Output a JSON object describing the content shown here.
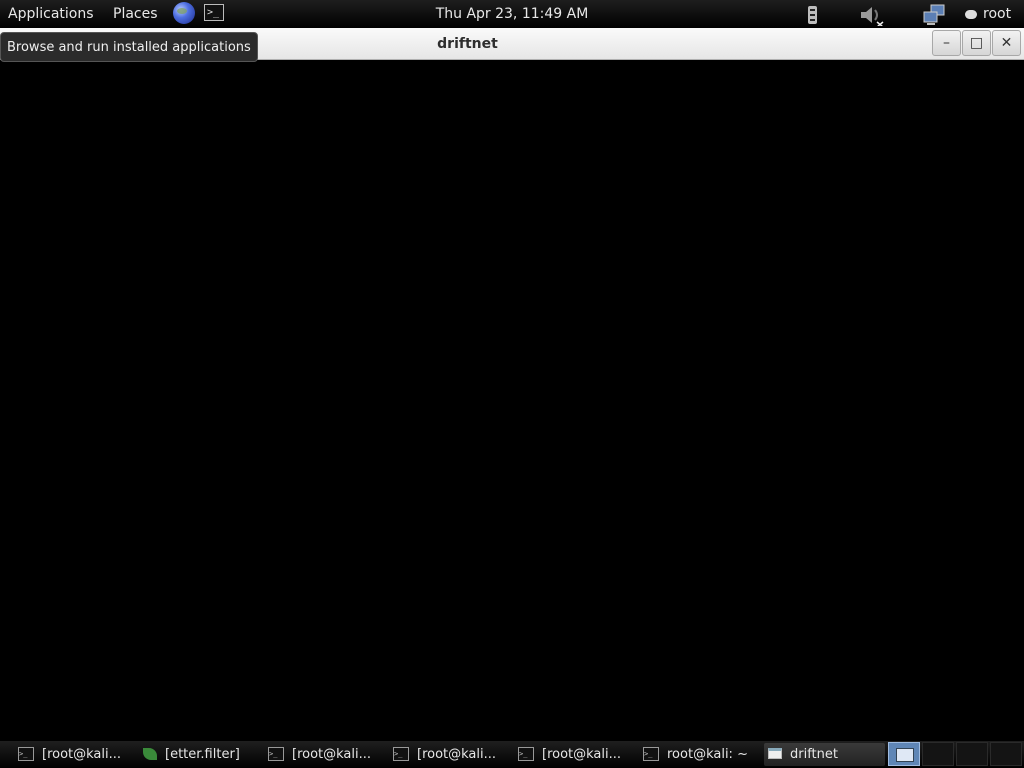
{
  "top_panel": {
    "applications_label": "Applications",
    "places_label": "Places",
    "terminal_launcher_glyph": ">_",
    "clock": "Thu Apr 23, 11:49 AM",
    "user_label": "root"
  },
  "tooltip": {
    "text": "Browse and run installed applications"
  },
  "window": {
    "title": "driftnet",
    "minimize_glyph": "–",
    "maximize_glyph": "□",
    "close_glyph": "✕"
  },
  "taskbar": {
    "tasks": [
      {
        "label": "[root@kali...",
        "icon": "terminal-icon"
      },
      {
        "label": "[etter.filter]",
        "icon": "text-editor-icon"
      },
      {
        "label": "[root@kali...",
        "icon": "terminal-icon"
      },
      {
        "label": "[root@kali...",
        "icon": "terminal-icon"
      },
      {
        "label": "[root@kali...",
        "icon": "terminal-icon"
      },
      {
        "label": "root@kali: ~",
        "icon": "terminal-icon"
      },
      {
        "label": "driftnet",
        "icon": "window-icon",
        "active": true
      }
    ],
    "workspaces": 4,
    "active_workspace": 1
  },
  "colors": {
    "panel_bg": "#000000",
    "titlebar_bg": "#eeeeee",
    "window_bg": "#000000",
    "workspace_active": "#5f86b6"
  }
}
